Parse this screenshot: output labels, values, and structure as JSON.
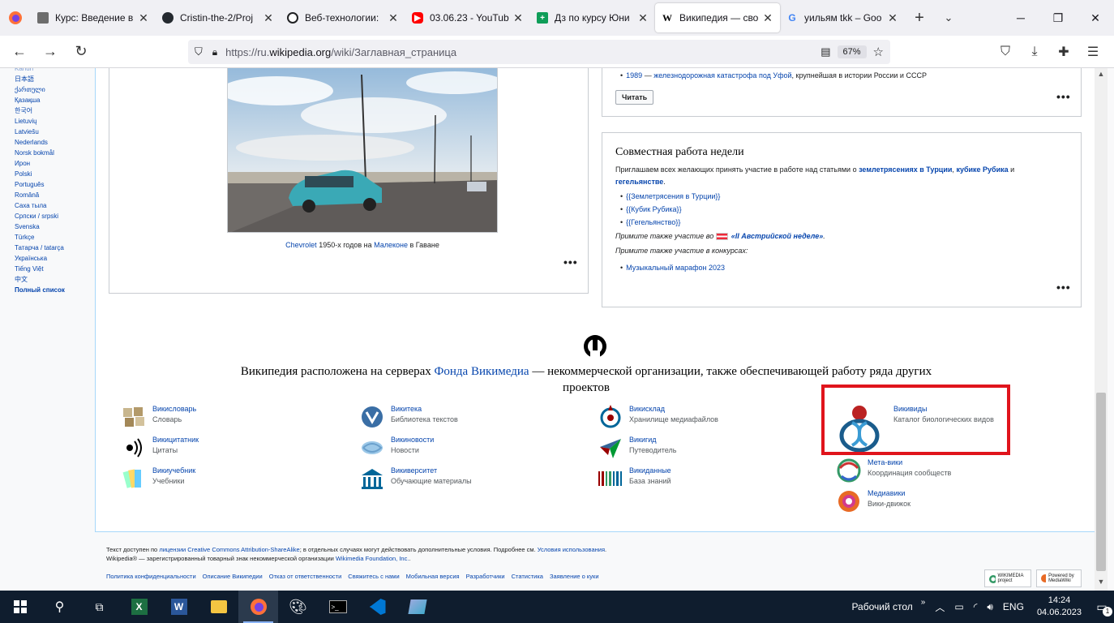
{
  "browser": {
    "tabs": [
      {
        "title": "Курс: Введение в",
        "icon": "book-icon",
        "active": false
      },
      {
        "title": "Cristin-the-2/Proj",
        "icon": "github-icon",
        "active": false
      },
      {
        "title": "Веб-технологии:",
        "icon": "openai-icon",
        "active": false
      },
      {
        "title": "03.06.23 - YouTub",
        "icon": "youtube-icon",
        "active": false
      },
      {
        "title": "Дз по курсу Юни",
        "icon": "sheets-icon",
        "active": false
      },
      {
        "title": "Википедия — сво",
        "icon": "wikipedia-icon",
        "active": true
      },
      {
        "title": "уильям tkk – Goo",
        "icon": "google-icon",
        "active": false
      }
    ],
    "url_prefix": "https://ru.",
    "url_domain": "wikipedia.org",
    "url_path": "/wiki/Заглавная_страница",
    "zoom": "67%"
  },
  "sidebar": {
    "languages": [
      "日本語",
      "ქართული",
      "Қазақша",
      "한국어",
      "Lietuvių",
      "Latviešu",
      "Nederlands",
      "Norsk bokmål",
      "Ирон",
      "Polski",
      "Português",
      "Română",
      "Саха тыла",
      "Српски / srpski",
      "Svenska",
      "Türkçe",
      "Татарча / tatarça",
      "Українська",
      "Tiếng Việt",
      "中文"
    ],
    "full_list": "Полный список"
  },
  "left_panel": {
    "caption_link1": "Chevrolet",
    "caption_text1": " 1950-х годов на ",
    "caption_link2": "Малеконе",
    "caption_text2": " в Гаване"
  },
  "history_box": {
    "item_year": "1989",
    "item_link": "железнодорожная катастрофа под Уфой",
    "item_rest": ", крупнейшая в истории России и СССР",
    "read_button": "Читать"
  },
  "collab_box": {
    "title": "Совместная работа недели",
    "intro": "Приглашаем всех желающих принять участие в работе над статьями о ",
    "link1": "землетрясениях в Турции",
    "sep1": ", ",
    "link2": "кубике Рубика",
    "sep2": " и ",
    "link3": "гегельянстве",
    "end": ".",
    "items": [
      "{{Землетрясения в Турции}}",
      "{{Кубик Рубика}}",
      "{{Гегельянство}}"
    ],
    "also1_text": "Примите также участие во ",
    "also1_link": "«II Австрийской неделе»",
    "also1_end": ".",
    "also2_text": "Примите также участие в конкурсах:",
    "contest": "Музыкальный марафон 2023"
  },
  "wikimedia": {
    "line_before": "Википедия расположена на серверах ",
    "link": "Фонда Викимедиа",
    "line_after": " — некоммерческой организации, также обеспечивающей работу ряда других проектов",
    "projects": [
      {
        "name": "Викисловарь",
        "desc": "Словарь",
        "icon": "wiktionary-icon"
      },
      {
        "name": "Викитека",
        "desc": "Библиотека текстов",
        "icon": "wikisource-icon"
      },
      {
        "name": "Викисклад",
        "desc": "Хранилище медиафайлов",
        "icon": "commons-icon"
      },
      {
        "name": "Викивиды",
        "desc": "Каталог биологических видов",
        "icon": "wikispecies-icon"
      },
      {
        "name": "Викицитатник",
        "desc": "Цитаты",
        "icon": "wikiquote-icon"
      },
      {
        "name": "Викиновости",
        "desc": "Новости",
        "icon": "wikinews-icon"
      },
      {
        "name": "Викигид",
        "desc": "Путеводитель",
        "icon": "wikivoyage-icon"
      },
      {
        "name": "Мета-вики",
        "desc": "Координация сообществ",
        "icon": "meta-icon"
      },
      {
        "name": "Викиучебник",
        "desc": "Учебники",
        "icon": "wikibooks-icon"
      },
      {
        "name": "Викиверситет",
        "desc": "Обучающие материалы",
        "icon": "wikiversity-icon"
      },
      {
        "name": "Викиданные",
        "desc": "База знаний",
        "icon": "wikidata-icon"
      },
      {
        "name": "Медиавики",
        "desc": "Вики-движок",
        "icon": "mediawiki-icon"
      }
    ]
  },
  "footer": {
    "l1a": "Текст доступен по ",
    "l1b": "лицензии Creative Commons Attribution-ShareAlike",
    "l1c": "; в отдельных случаях могут действовать дополнительные условия. Подробнее см. ",
    "l1d": "Условия использования",
    "l1e": ".",
    "l2a": "Wikipedia® — зарегистрированный товарный знак некоммерческой организации ",
    "l2b": "Wikimedia Foundation, Inc.",
    "l2c": ".",
    "links": [
      "Политика конфиденциальности",
      "Описание Википедии",
      "Отказ от ответственности",
      "Свяжитесь с нами",
      "Мобильная версия",
      "Разработчики",
      "Статистика",
      "Заявление о куки"
    ],
    "badge1": "WIKIMEDIA project",
    "badge2": "Powered by MediaWiki"
  },
  "taskbar": {
    "desktop_label": "Рабочий стол",
    "lang": "ENG",
    "time": "14:24",
    "date": "04.06.2023",
    "notif": "1"
  }
}
